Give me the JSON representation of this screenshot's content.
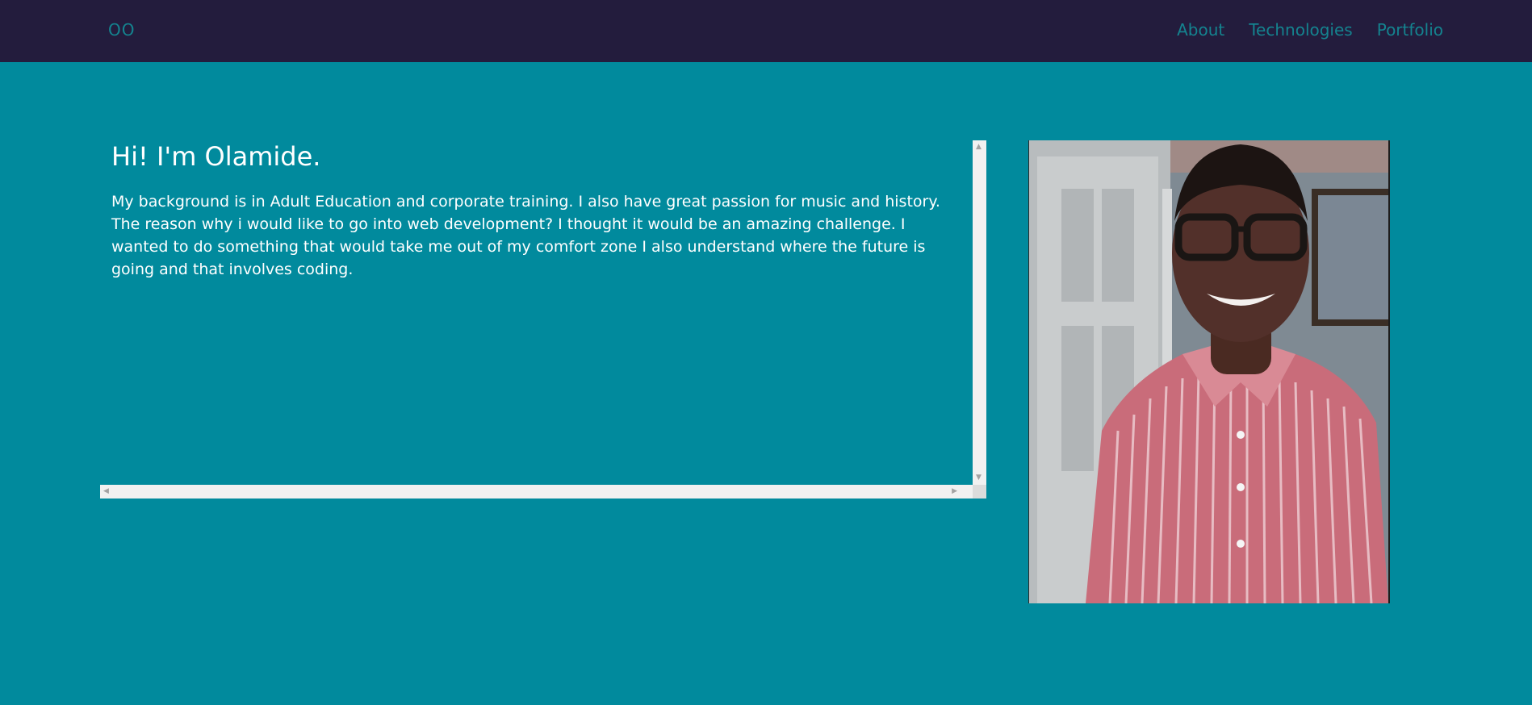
{
  "nav": {
    "brand": "OO",
    "links": [
      {
        "label": "About"
      },
      {
        "label": "Technologies"
      },
      {
        "label": "Portfolio"
      }
    ]
  },
  "about": {
    "title": "Hi! I'm Olamide.",
    "body": "My background is in Adult Education and corporate training. I also have great passion for music and history. The reason why i would like to go into web development? I thought it would be an amazing challenge. I wanted to do something that would take me out of my comfort zone I also understand where the future is going and that involves coding."
  },
  "colors": {
    "page_bg": "#018a9d",
    "navbar_bg": "#231c3d",
    "nav_text": "#14838f",
    "text": "#ffffff"
  }
}
